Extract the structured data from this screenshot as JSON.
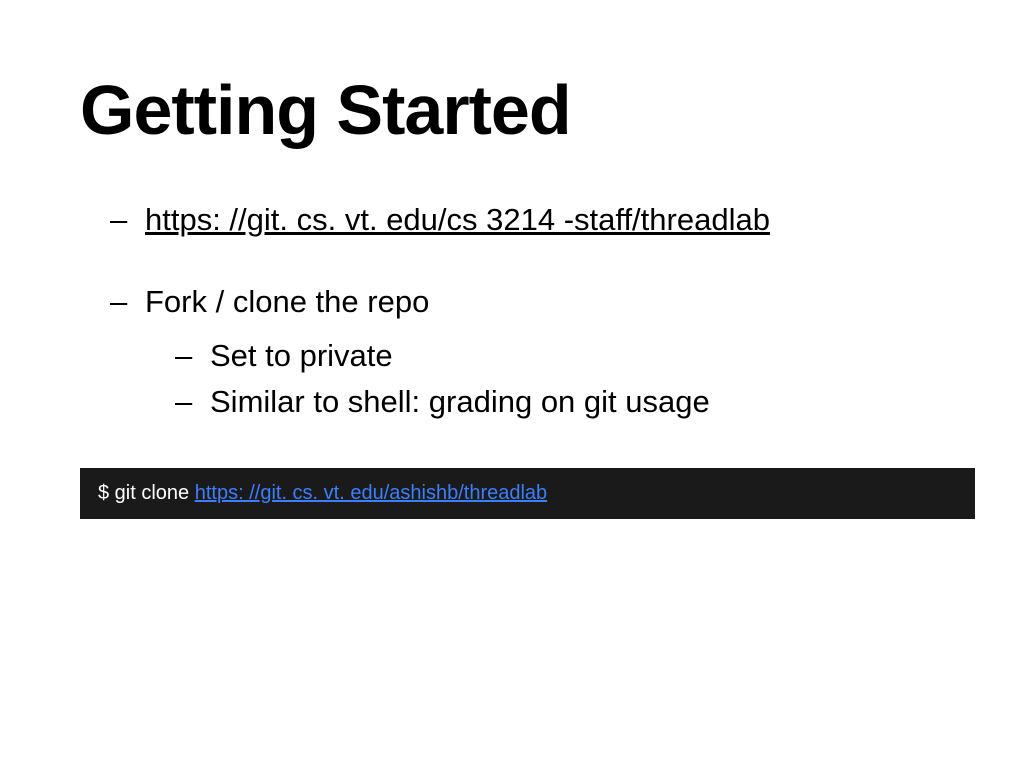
{
  "title": "Getting Started",
  "bullets": {
    "link_text": "https: //git. cs. vt. edu/cs 3214 -staff/threadlab",
    "fork_text": "Fork / clone the repo",
    "sub1": "Set to private",
    "sub2": "Similar to shell: grading on git usage"
  },
  "code": {
    "prefix": "$ git clone ",
    "url": "https: //git. cs. vt. edu/ashishb/threadlab"
  }
}
